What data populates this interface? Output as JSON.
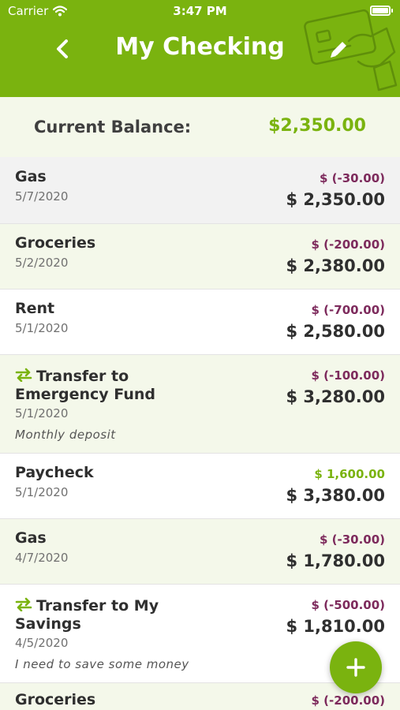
{
  "status_bar": {
    "carrier": "Carrier",
    "time": "3:47 PM"
  },
  "header": {
    "title": "My Checking"
  },
  "balance": {
    "label": "Current Balance:",
    "value": "$2,350.00"
  },
  "colors": {
    "brand": "#7ab30f",
    "withdrawal": "#7d2a5c",
    "deposit": "#7ab30f",
    "row_alt": "#f4f8ea",
    "row_first": "#f2f2f2"
  },
  "transactions": [
    {
      "description": "Gas",
      "date": "5/7/2020",
      "amount": "$  (-30.00)",
      "running": "$  2,350.00"
    },
    {
      "description": "Groceries",
      "date": "5/2/2020",
      "amount": "$  (-200.00)",
      "running": "$  2,380.00"
    },
    {
      "description": "Rent",
      "date": "5/1/2020",
      "amount": "$  (-700.00)",
      "running": "$  2,580.00"
    },
    {
      "description_line1": "Transfer to",
      "description_line2": "Emergency Fund",
      "date": "5/1/2020",
      "note": "Monthly deposit",
      "amount": "$  (-100.00)",
      "running": "$  3,280.00"
    },
    {
      "description": "Paycheck",
      "date": "5/1/2020",
      "amount": "$  1,600.00",
      "running": "$  3,380.00"
    },
    {
      "description": "Gas",
      "date": "4/7/2020",
      "amount": "$  (-30.00)",
      "running": "$  1,780.00"
    },
    {
      "description_line1": "Transfer to My",
      "description_line2": "Savings",
      "date": "4/5/2020",
      "note": "I need to save some money",
      "amount": "$  (-500.00)",
      "running": "$  1,810.00"
    },
    {
      "description": "Groceries",
      "amount": "$  (-200.00)"
    }
  ]
}
